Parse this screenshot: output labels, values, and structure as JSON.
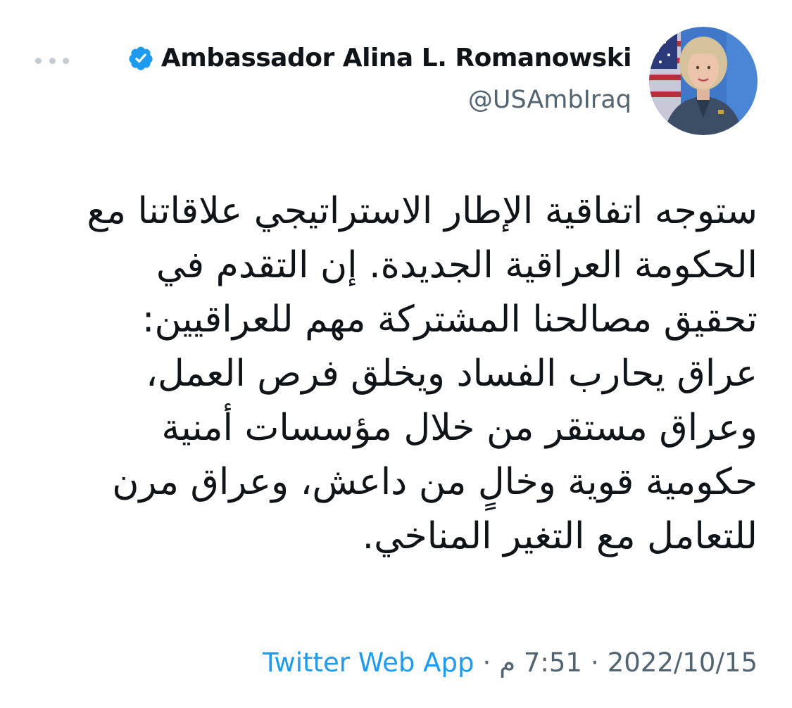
{
  "tweet": {
    "author": {
      "display_name": "Ambassador Alina L. Romanowski",
      "handle": "@USAmbIraq",
      "verified_icon": "verified-badge-icon",
      "avatar_icon": "profile-photo"
    },
    "more_icon": "more-horizontal-icon",
    "text_lines": [
      "ستوجه اتفاقية الإطار الاستراتيجي علاقاتنا مع",
      "الحكومة العراقية الجديدة. إن التقدم في",
      "تحقيق مصالحنا المشتركة مهم للعراقيين:",
      "عراق يحارب الفساد ويخلق فرص العمل،",
      "وعراق مستقر من خلال مؤسسات أمنية",
      "حكومية قوية وخالٍ من داعش، وعراق مرن",
      "للتعامل مع التغير المناخي."
    ],
    "meta": {
      "date": "2022/10/15",
      "separator": "·",
      "time": "7:51 م",
      "source": "Twitter Web App"
    }
  },
  "colors": {
    "text": "#0f1419",
    "secondary": "#536471",
    "accent": "#1d9bf0"
  }
}
